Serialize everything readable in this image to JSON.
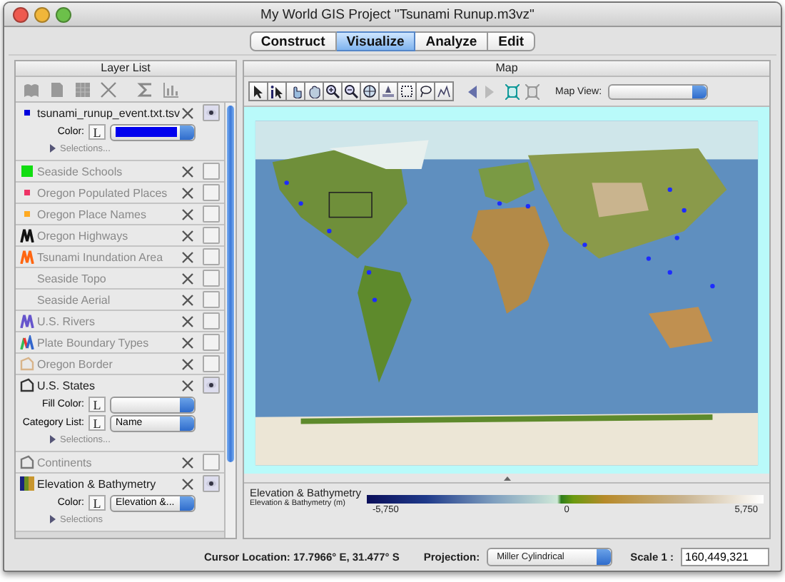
{
  "window": {
    "title": "My World GIS Project \"Tsunami Runup.m3vz\""
  },
  "tabs": [
    {
      "label": "Construct",
      "selected": false
    },
    {
      "label": "Visualize",
      "selected": true
    },
    {
      "label": "Analyze",
      "selected": false
    },
    {
      "label": "Edit",
      "selected": false
    }
  ],
  "layer_list": {
    "title": "Layer List",
    "layers": [
      {
        "name": "tsunami_runup_event.txt.tsv",
        "kind": "dot",
        "color": "#0000dd",
        "visible": true,
        "expanded": true,
        "controls": [
          {
            "kind": "swatch",
            "label": "Color:",
            "button": "L",
            "color": "#0000ee"
          }
        ],
        "selections": "Selections..."
      },
      {
        "name": "Seaside Schools",
        "kind": "square",
        "color": "#11dd11",
        "visible": false,
        "expanded": false
      },
      {
        "name": "Oregon Populated Places",
        "kind": "dot",
        "color": "#ee3366",
        "visible": false,
        "expanded": false
      },
      {
        "name": "Oregon Place Names",
        "kind": "dot",
        "color": "#ffaa22",
        "visible": false,
        "expanded": false
      },
      {
        "name": "Oregon Highways",
        "kind": "line",
        "color": "#111111",
        "visible": false,
        "expanded": false
      },
      {
        "name": "Tsunami Inundation Area",
        "kind": "line",
        "color": "#ff6611",
        "visible": false,
        "expanded": false
      },
      {
        "name": "Seaside Topo",
        "visible": false,
        "expanded": false
      },
      {
        "name": "Seaside Aerial",
        "visible": false,
        "expanded": false
      },
      {
        "name": "U.S. Rivers",
        "kind": "line",
        "color": "#6655cc",
        "visible": false,
        "expanded": false
      },
      {
        "name": "Plate Boundary Types",
        "kind": "multiline",
        "visible": false,
        "expanded": false
      },
      {
        "name": "Oregon Border",
        "kind": "polygon",
        "color": "#d8b48a",
        "visible": false,
        "expanded": false
      },
      {
        "name": "U.S. States",
        "kind": "polygon",
        "color": "#333333",
        "visible": true,
        "expanded": true,
        "controls": [
          {
            "kind": "select",
            "label": "Fill Color:",
            "button": "L"
          },
          {
            "kind": "select",
            "label": "Category List:",
            "button": "L",
            "value": "Name"
          }
        ],
        "selections": "Selections..."
      },
      {
        "name": "Continents",
        "kind": "polygon",
        "color": "#777777",
        "visible": false,
        "expanded": false
      },
      {
        "name": "Elevation & Bathymetry",
        "kind": "raster",
        "visible": true,
        "expanded": true,
        "controls": [
          {
            "kind": "select",
            "label": "Color:",
            "button": "L",
            "value": "Elevation &..."
          }
        ],
        "selections": "Selections"
      }
    ]
  },
  "map": {
    "title": "Map",
    "map_view": {
      "label": "Map View:"
    },
    "legend": {
      "title": "Elevation & Bathymetry",
      "subtitle": "Elevation & Bathymetry (m)",
      "min": "-5,750",
      "mid": "0",
      "max": "5,750"
    }
  },
  "status_bar": {
    "cursor": "Cursor Location: 17.7966° E, 31.477° S",
    "projection_label": "Projection:",
    "projection": "Miller Cylindrical",
    "scale_label": "Scale 1 :",
    "scale": "160,449,321"
  }
}
